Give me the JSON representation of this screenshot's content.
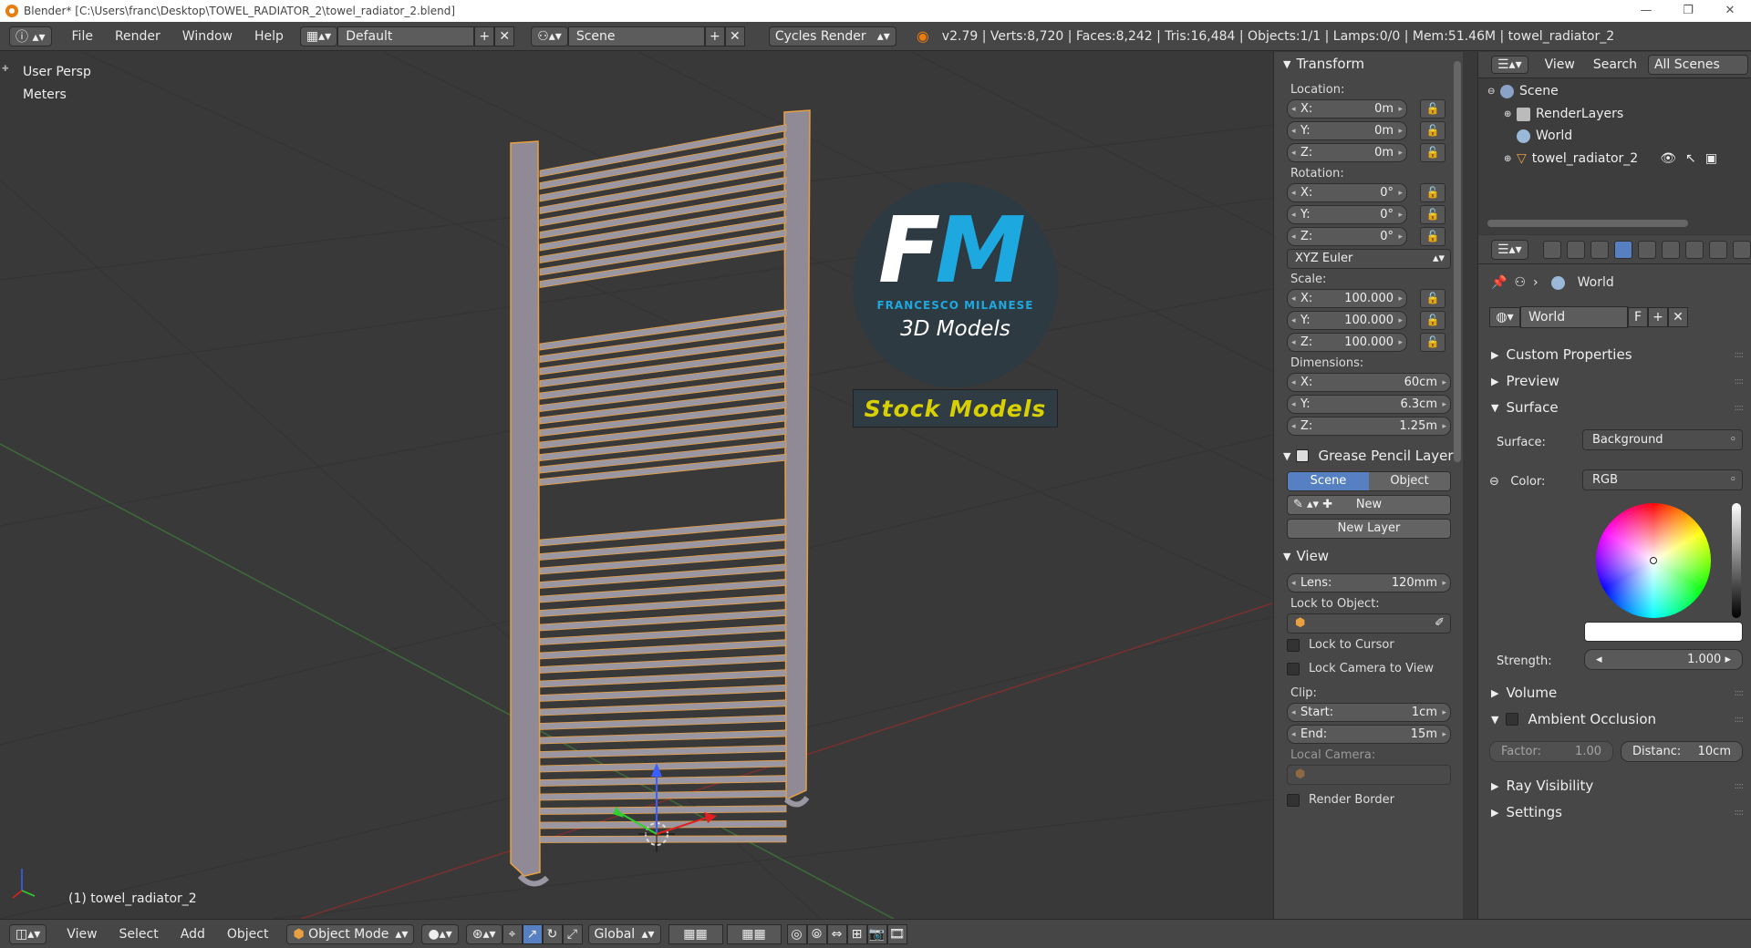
{
  "titlebar": {
    "title": "Blender* [C:\\Users\\franc\\Desktop\\TOWEL_RADIATOR_2\\towel_radiator_2.blend]"
  },
  "topbar": {
    "menus": [
      "File",
      "Render",
      "Window",
      "Help"
    ],
    "layout": "Default",
    "scene": "Scene",
    "engine": "Cycles Render",
    "stats": "v2.79 | Verts:8,720 | Faces:8,242 | Tris:16,484 | Objects:1/1 | Lamps:0/0 | Mem:51.46M | towel_radiator_2"
  },
  "viewport": {
    "view_name": "User Persp",
    "units": "Meters",
    "object_label": "(1) towel_radiator_2",
    "watermark": {
      "initials_f": "F",
      "initials_m": "M",
      "name": "FRANCESCO MILANESE",
      "sub": "3D Models",
      "badge": "Stock Models"
    }
  },
  "npanel": {
    "transform": {
      "title": "Transform",
      "location_label": "Location:",
      "loc": [
        {
          "k": "X:",
          "v": "0m"
        },
        {
          "k": "Y:",
          "v": "0m"
        },
        {
          "k": "Z:",
          "v": "0m"
        }
      ],
      "rotation_label": "Rotation:",
      "rot": [
        {
          "k": "X:",
          "v": "0°"
        },
        {
          "k": "Y:",
          "v": "0°"
        },
        {
          "k": "Z:",
          "v": "0°"
        }
      ],
      "rot_mode": "XYZ Euler",
      "scale_label": "Scale:",
      "scale": [
        {
          "k": "X:",
          "v": "100.000"
        },
        {
          "k": "Y:",
          "v": "100.000"
        },
        {
          "k": "Z:",
          "v": "100.000"
        }
      ],
      "dim_label": "Dimensions:",
      "dim": [
        {
          "k": "X:",
          "v": "60cm"
        },
        {
          "k": "Y:",
          "v": "6.3cm"
        },
        {
          "k": "Z:",
          "v": "1.25m"
        }
      ]
    },
    "grease": {
      "title": "Grease Pencil Layer",
      "scene": "Scene",
      "object": "Object",
      "new": "New",
      "new_layer": "New Layer"
    },
    "view": {
      "title": "View",
      "lens_k": "Lens:",
      "lens_v": "120mm",
      "lock_obj": "Lock to Object:",
      "lock_cursor": "Lock to Cursor",
      "lock_camera": "Lock Camera to View",
      "clip": "Clip:",
      "start_k": "Start:",
      "start_v": "1cm",
      "end_k": "End:",
      "end_v": "15m",
      "local_camera": "Local Camera:",
      "render_border": "Render Border"
    }
  },
  "outliner": {
    "menus": [
      "View",
      "Search"
    ],
    "filter": "All Scenes",
    "items": [
      "Scene",
      "RenderLayers",
      "World",
      "towel_radiator_2"
    ]
  },
  "properties": {
    "context": "World",
    "world_name": "World",
    "fake_user": "F",
    "sections": {
      "custom": "Custom Properties",
      "preview": "Preview",
      "surface": "Surface",
      "volume": "Volume",
      "ao": "Ambient Occlusion",
      "ray": "Ray Visibility",
      "settings": "Settings"
    },
    "surface_label": "Surface:",
    "surface_value": "Background",
    "color_label": "Color:",
    "color_value": "RGB",
    "strength_k": "Strength:",
    "strength_v": "1.000",
    "factor_k": "Factor:",
    "factor_v": "1.00",
    "dist_k": "Distanc:",
    "dist_v": "10cm"
  },
  "bottombar": {
    "menus": [
      "View",
      "Select",
      "Add",
      "Object"
    ],
    "mode": "Object Mode",
    "orientation": "Global"
  },
  "colors": {
    "accent": "#5680c2",
    "brand_blue": "#1ea8e0",
    "stock_yellow": "#d8d000",
    "selection_outline": "#e8a040"
  }
}
